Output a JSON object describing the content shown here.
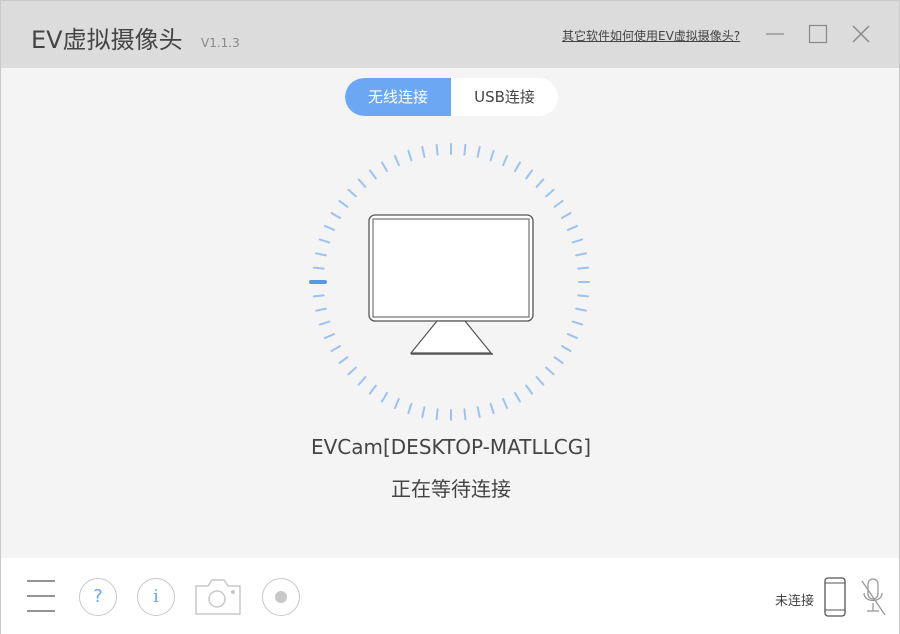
{
  "titlebar": {
    "title": "EV虚拟摄像头",
    "version": "V1.1.3",
    "help_link": "其它软件如何使用EV虚拟摄像头?"
  },
  "tabs": [
    {
      "label": "无线连接",
      "active": true
    },
    {
      "label": "USB连接",
      "active": false
    }
  ],
  "main": {
    "device_name": "EVCam[DESKTOP-MATLLCG]",
    "status": "正在等待连接"
  },
  "bottombar": {
    "help_glyph": "?",
    "info_glyph": "i",
    "connection_status": "未连接"
  },
  "colors": {
    "accent": "#6ba7f2",
    "titlebar_bg": "#dcdcdc",
    "body_bg": "#f4f4f4",
    "icon_gray": "#c8c8c8"
  },
  "icons": [
    "minimize-icon",
    "maximize-icon",
    "close-icon",
    "monitor-icon",
    "menu-icon",
    "help-icon",
    "info-icon",
    "camera-icon",
    "record-icon",
    "phone-icon",
    "mic-muted-icon"
  ]
}
